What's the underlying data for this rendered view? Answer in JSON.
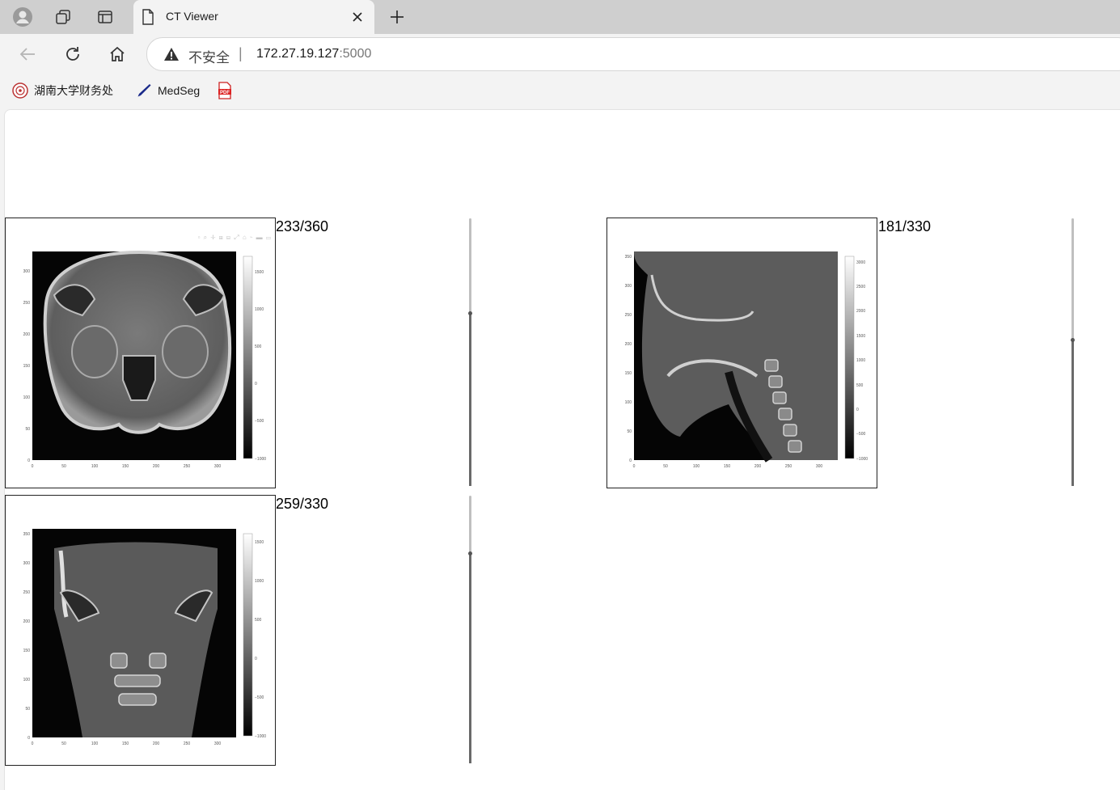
{
  "browser": {
    "tab_title": "CT Viewer",
    "address": {
      "security_label": "不安全",
      "separator": "|",
      "host": "172.27.19.127",
      "port": ":5000"
    },
    "bookmarks": [
      {
        "label": "湖南大学财务处",
        "icon": "university-seal-icon"
      },
      {
        "label": "MedSeg",
        "icon": "pen-icon"
      },
      {
        "label": "",
        "icon": "pdf-icon"
      }
    ]
  },
  "viewers": [
    {
      "plane": "axial",
      "counter": "233/360",
      "slider_fraction": 0.647,
      "x_ticks": [
        "0",
        "50",
        "100",
        "150",
        "200",
        "250",
        "300"
      ],
      "y_ticks": [
        "0",
        "50",
        "100",
        "150",
        "200",
        "250",
        "300"
      ],
      "colorbar_ticks": [
        "−1000",
        "−500",
        "0",
        "500",
        "1000",
        "1500"
      ],
      "modebar": "▫ ⌕ ✛ ⊞ ⊟ ⤢ ⌂ ⌁ ▬ ▭"
    },
    {
      "plane": "sagittal",
      "counter": "181/330",
      "slider_fraction": 0.548,
      "x_ticks": [
        "0",
        "50",
        "100",
        "150",
        "200",
        "250",
        "300"
      ],
      "y_ticks": [
        "0",
        "50",
        "100",
        "150",
        "200",
        "250",
        "300",
        "350"
      ],
      "colorbar_ticks": [
        "−1000",
        "−500",
        "0",
        "500",
        "1000",
        "1500",
        "2000",
        "2500",
        "3000"
      ]
    },
    {
      "plane": "coronal",
      "counter": "259/330",
      "slider_fraction": 0.785,
      "x_ticks": [
        "0",
        "50",
        "100",
        "150",
        "200",
        "250",
        "300"
      ],
      "y_ticks": [
        "0",
        "50",
        "100",
        "150",
        "200",
        "250",
        "300",
        "350"
      ],
      "colorbar_ticks": [
        "−1000",
        "−500",
        "0",
        "500",
        "1000",
        "1500"
      ]
    }
  ],
  "colors": {
    "tabstrip": "#cfcfcf",
    "chrome": "#f3f3f3",
    "slider_fill": "#6a6a6a"
  }
}
